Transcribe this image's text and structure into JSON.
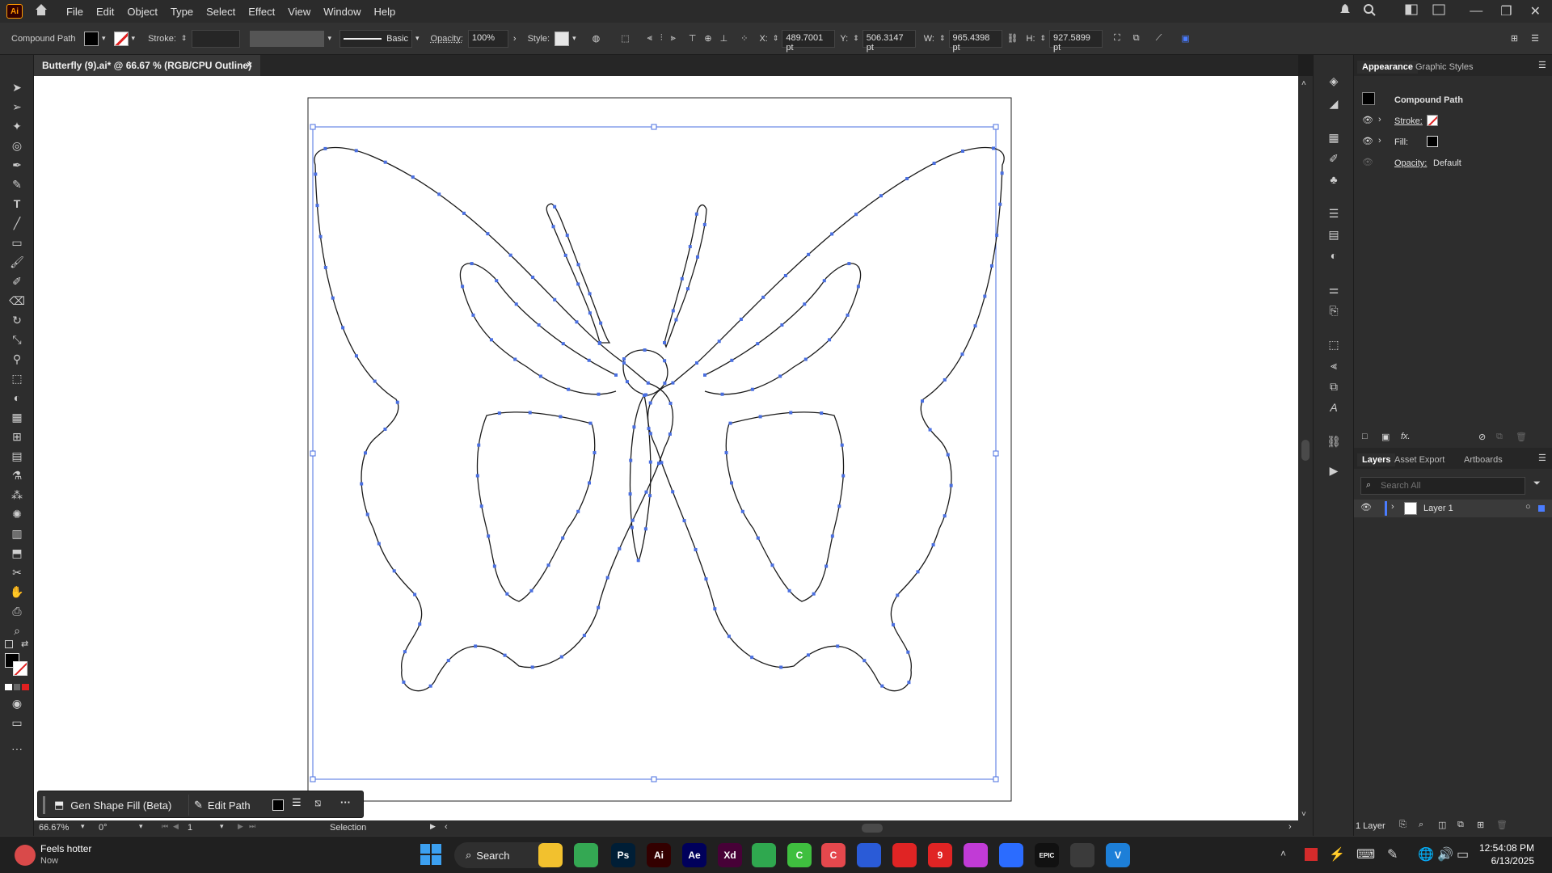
{
  "menubar": {
    "logo": "Ai",
    "items": [
      "File",
      "Edit",
      "Object",
      "Type",
      "Select",
      "Effect",
      "View",
      "Window",
      "Help"
    ]
  },
  "controlbar": {
    "selection_type": "Compound Path",
    "stroke_label": "Stroke:",
    "brush_label": "Basic",
    "opacity_label": "Opacity:",
    "opacity_value": "100%",
    "style_label": "Style:",
    "x_label": "X:",
    "x_value": "489.7001 pt",
    "y_label": "Y:",
    "y_value": "506.3147 pt",
    "w_label": "W:",
    "w_value": "965.4398 pt",
    "h_label": "H:",
    "h_value": "927.5899 pt"
  },
  "document": {
    "tab_title": "Butterfly (9).ai* @ 66.67 % (RGB/CPU Outline)",
    "close": "×"
  },
  "floating_bar": {
    "gen_fill": "Gen Shape Fill (Beta)",
    "edit_path": "Edit Path",
    "more": "···"
  },
  "status": {
    "zoom": "66.67%",
    "rotation": "0°",
    "artboard": "1",
    "tool": "Selection"
  },
  "appearance_panel": {
    "tab_active": "Appearance",
    "tab_other": "Graphic Styles",
    "object": "Compound Path",
    "stroke": "Stroke:",
    "fill": "Fill:",
    "opacity": "Opacity:",
    "opacity_value": "Default",
    "fx": "fx."
  },
  "layers_panel": {
    "tabs": [
      "Layers",
      "Asset Export",
      "Artboards"
    ],
    "search_placeholder": "Search All",
    "layer_name": "Layer 1",
    "count": "1 Layer"
  },
  "taskbar": {
    "weather_title": "Feels hotter",
    "weather_sub": "Now",
    "search": "Search",
    "time": "12:54:08 PM",
    "date": "6/13/2025",
    "apps": [
      {
        "name": "file-explorer",
        "label": "",
        "color": "#f2c12e"
      },
      {
        "name": "chrome",
        "label": "",
        "color": "#34a853"
      },
      {
        "name": "photoshop",
        "label": "Ps",
        "color": "#001e36"
      },
      {
        "name": "illustrator",
        "label": "Ai",
        "color": "#330000"
      },
      {
        "name": "after-effects",
        "label": "Ae",
        "color": "#00005b"
      },
      {
        "name": "xd",
        "label": "Xd",
        "color": "#470137"
      },
      {
        "name": "app-green",
        "label": "",
        "color": "#2fa84f"
      },
      {
        "name": "app-c-green",
        "label": "C",
        "color": "#3fbf3f"
      },
      {
        "name": "app-c-red",
        "label": "C",
        "color": "#e5484d"
      },
      {
        "name": "app-blue",
        "label": "",
        "color": "#2a5bd7"
      },
      {
        "name": "app-red",
        "label": "",
        "color": "#e02424"
      },
      {
        "name": "app-9",
        "label": "9",
        "color": "#e02424"
      },
      {
        "name": "app-badge",
        "label": "",
        "color": "#c13bd6"
      },
      {
        "name": "app-bolt",
        "label": "",
        "color": "#2b6cff"
      },
      {
        "name": "epic",
        "label": "EPIC",
        "color": "#111111"
      },
      {
        "name": "app-active",
        "label": "",
        "color": "#3b3b3b"
      },
      {
        "name": "app-v",
        "label": "V",
        "color": "#1d7fd8"
      }
    ]
  },
  "colors": {
    "accent": "#4a7cff",
    "selection": "#4a6fe0"
  }
}
